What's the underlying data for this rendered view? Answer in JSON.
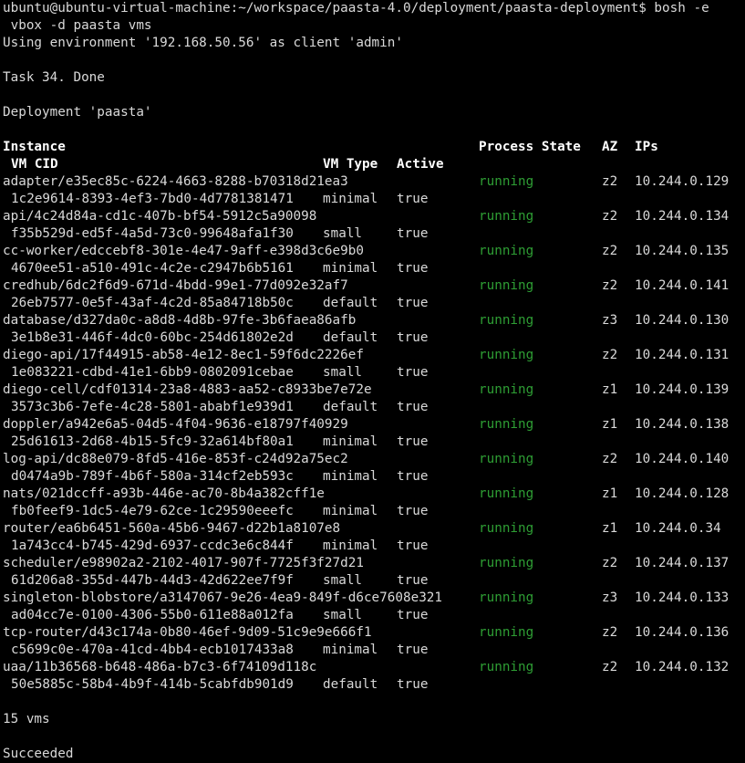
{
  "terminal": {
    "prompt": "ubuntu@ubuntu-virtual-machine:~/workspace/paasta-4.0/deployment/paasta-deployment$ bosh -e",
    "command_cont": " vbox -d paasta vms",
    "env_line": "Using environment '192.168.50.56' as client 'admin'",
    "task_line": "Task 34. Done",
    "deployment_line": "Deployment 'paasta'",
    "headers": {
      "instance": "Instance",
      "process_state": "Process State",
      "az": "AZ",
      "ips": "IPs",
      "vm_cid": "VM CID",
      "vm_type": "VM Type",
      "active": "Active"
    },
    "rows": [
      {
        "instance": "adapter/e35ec85c-6224-4663-8288-b70318d21ea3",
        "state": "running",
        "az": "z2",
        "ip": "10.244.0.129",
        "cid": "1c2e9614-8393-4ef3-7bd0-4d7781381471",
        "type": "minimal",
        "active": "true"
      },
      {
        "instance": "api/4c24d84a-cd1c-407b-bf54-5912c5a90098",
        "state": "running",
        "az": "z2",
        "ip": "10.244.0.134",
        "cid": "f35b529d-ed5f-4a5d-73c0-99648afa1f30",
        "type": "small",
        "active": "true"
      },
      {
        "instance": "cc-worker/edccebf8-301e-4e47-9aff-e398d3c6e9b0",
        "state": "running",
        "az": "z2",
        "ip": "10.244.0.135",
        "cid": "4670ee51-a510-491c-4c2e-c2947b6b5161",
        "type": "minimal",
        "active": "true"
      },
      {
        "instance": "credhub/6dc2f6d9-671d-4bdd-99e1-77d092e32af7",
        "state": "running",
        "az": "z2",
        "ip": "10.244.0.141",
        "cid": "26eb7577-0e5f-43af-4c2d-85a84718b50c",
        "type": "default",
        "active": "true"
      },
      {
        "instance": "database/d327da0c-a8d8-4d8b-97fe-3b6faea86afb",
        "state": "running",
        "az": "z3",
        "ip": "10.244.0.130",
        "cid": "3e1b8e31-446f-4dc0-60bc-254d61802e2d",
        "type": "default",
        "active": "true"
      },
      {
        "instance": "diego-api/17f44915-ab58-4e12-8ec1-59f6dc2226ef",
        "state": "running",
        "az": "z2",
        "ip": "10.244.0.131",
        "cid": "1e083221-cdbd-41e1-6bb9-0802091cebae",
        "type": "small",
        "active": "true"
      },
      {
        "instance": "diego-cell/cdf01314-23a8-4883-aa52-c8933be7e72e",
        "state": "running",
        "az": "z1",
        "ip": "10.244.0.139",
        "cid": "3573c3b6-7efe-4c28-5801-ababf1e939d1",
        "type": "default",
        "active": "true"
      },
      {
        "instance": "doppler/a942e6a5-04d5-4f04-9636-e18797f40929",
        "state": "running",
        "az": "z1",
        "ip": "10.244.0.138",
        "cid": "25d61613-2d68-4b15-5fc9-32a614bf80a1",
        "type": "minimal",
        "active": "true"
      },
      {
        "instance": "log-api/dc88e079-8fd5-416e-853f-c24d92a75ec2",
        "state": "running",
        "az": "z2",
        "ip": "10.244.0.140",
        "cid": "d0474a9b-789f-4b6f-580a-314cf2eb593c",
        "type": "minimal",
        "active": "true"
      },
      {
        "instance": "nats/021dccff-a93b-446e-ac70-8b4a382cff1e",
        "state": "running",
        "az": "z1",
        "ip": "10.244.0.128",
        "cid": "fb0feef9-1dc5-4e79-62ce-1c29590eeefc",
        "type": "minimal",
        "active": "true"
      },
      {
        "instance": "router/ea6b6451-560a-45b6-9467-d22b1a8107e8",
        "state": "running",
        "az": "z1",
        "ip": "10.244.0.34",
        "cid": "1a743cc4-b745-429d-6937-ccdc3e6c844f",
        "type": "minimal",
        "active": "true"
      },
      {
        "instance": "scheduler/e98902a2-2102-4017-907f-7725f3f27d21",
        "state": "running",
        "az": "z2",
        "ip": "10.244.0.137",
        "cid": "61d206a8-355d-447b-44d3-42d622ee7f9f",
        "type": "small",
        "active": "true"
      },
      {
        "instance": "singleton-blobstore/a3147067-9e26-4ea9-849f-d6ce7608e321",
        "state": "running",
        "az": "z3",
        "ip": "10.244.0.133",
        "cid": "ad04cc7e-0100-4306-55b0-611e88a012fa",
        "type": "small",
        "active": "true"
      },
      {
        "instance": "tcp-router/d43c174a-0b80-46ef-9d09-51c9e9e666f1",
        "state": "running",
        "az": "z2",
        "ip": "10.244.0.136",
        "cid": "c5699c0e-470a-41cd-4bb4-ecb1017433a8",
        "type": "minimal",
        "active": "true"
      },
      {
        "instance": "uaa/11b36568-b648-486a-b7c3-6f74109d118c",
        "state": "running",
        "az": "z2",
        "ip": "10.244.0.132",
        "cid": "50e5885c-58b4-4b9f-414b-5cabfdb901d9",
        "type": "default",
        "active": "true"
      }
    ],
    "count_line": "15 vms",
    "result_line": "Succeeded"
  },
  "colors": {
    "background": "#000000",
    "text": "#d9d9d9",
    "running": "#2e9e34"
  }
}
